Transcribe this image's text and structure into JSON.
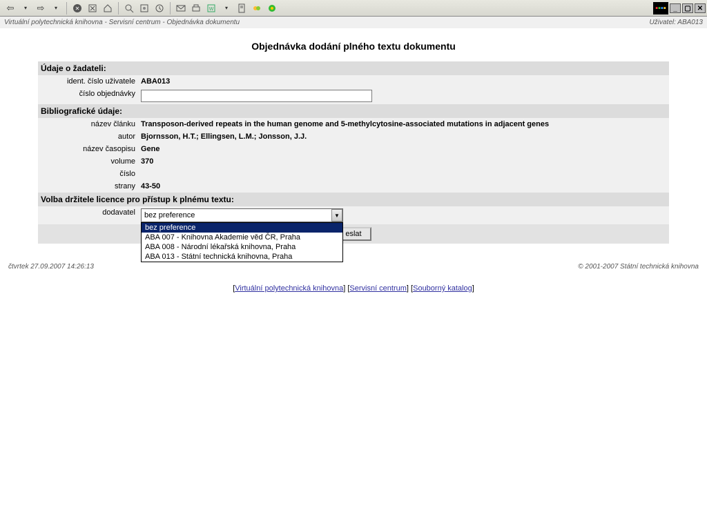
{
  "breadcrumb": "Virtuální polytechnická knihovna - Servisní centrum - Objednávka dokumentu",
  "user_label": "Uživatel: ABA013",
  "page_title": "Objednávka dodání plného textu dokumentu",
  "sections": {
    "requester": "Údaje o žadateli:",
    "biblio": "Bibliografické údaje:",
    "licence": "Volba držitele licence pro přístup k plnému textu:"
  },
  "labels": {
    "ident": "ident. číslo uživatele",
    "order_no": "číslo objednávky",
    "article_title": "název článku",
    "author": "autor",
    "journal": "název časopisu",
    "volume": "volume",
    "issue": "číslo",
    "pages": "strany",
    "supplier": "dodavatel"
  },
  "values": {
    "ident": "ABA013",
    "order_no": "",
    "article_title": "Transposon-derived repeats in the human genome and 5-methylcytosine-associated mutations in adjacent genes",
    "author": "Bjornsson, H.T.; Ellingsen, L.M.; Jonsson, J.J.",
    "journal": "Gene",
    "volume": "370",
    "issue": "",
    "pages": "43-50",
    "supplier_selected": "bez preference"
  },
  "supplier_options": [
    "bez preference",
    "ABA 007 - Knihovna Akademie věd ČR, Praha",
    "ABA 008 - Národní lékařská knihovna, Praha",
    "ABA 013 - Státní technická knihovna, Praha"
  ],
  "submit_label": "eslat",
  "footer": {
    "timestamp": "čtvrtek 27.09.2007 14:26:13",
    "copyright": "© 2001-2007 Státní technická knihovna"
  },
  "links": {
    "vpk": "Virtuální polytechnická knihovna",
    "sc": "Servisní centrum",
    "sk": "Souborný katalog"
  }
}
